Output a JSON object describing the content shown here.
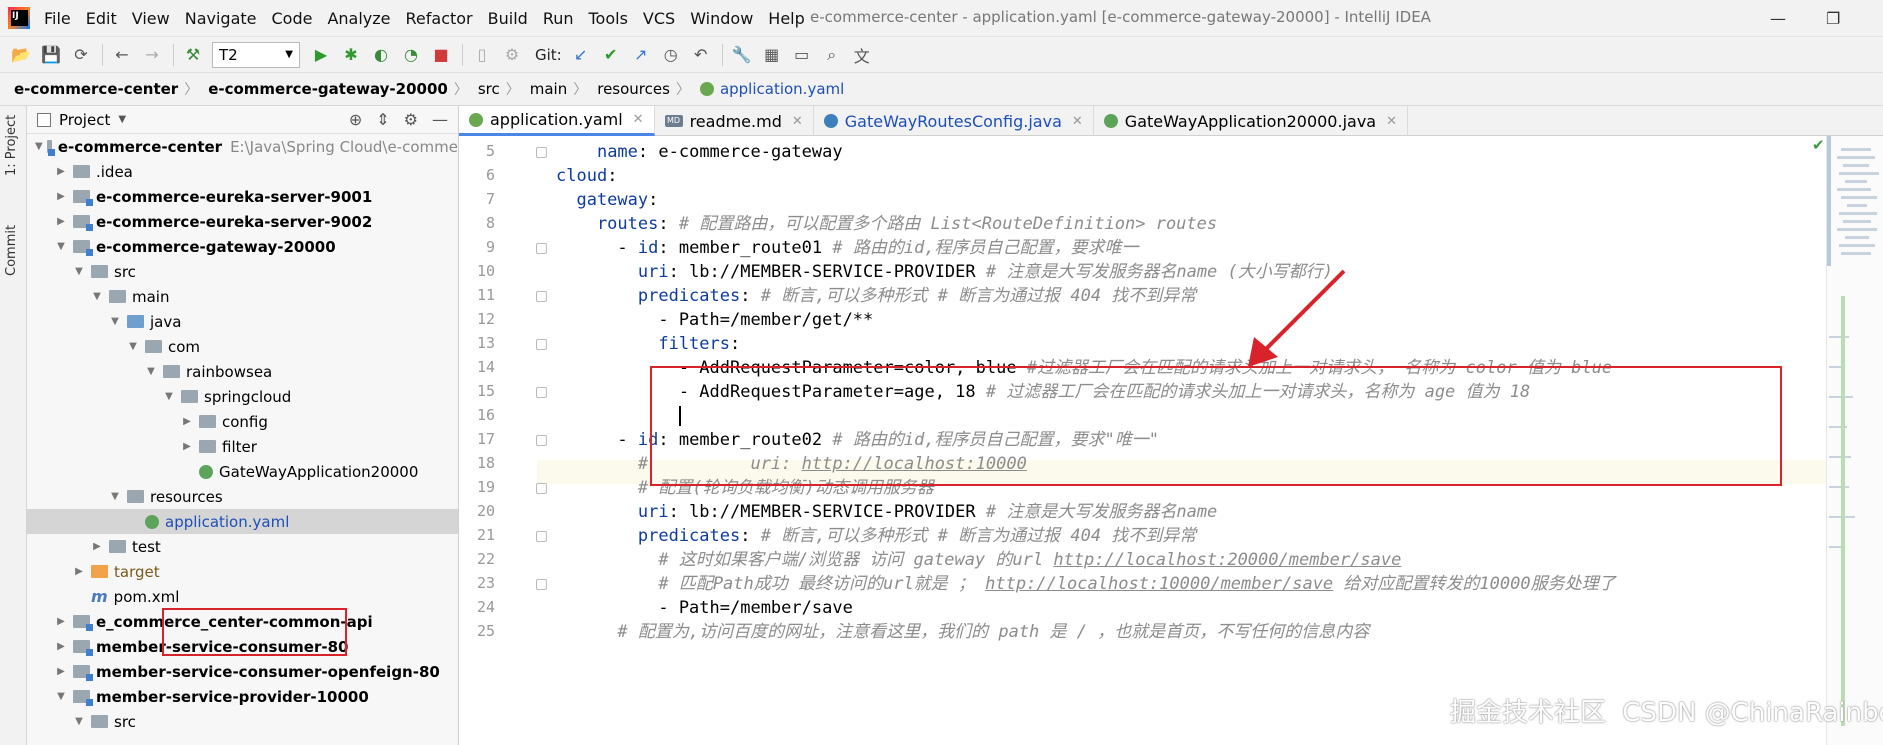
{
  "window": {
    "title": "e-commerce-center - application.yaml [e-commerce-gateway-20000] - IntelliJ IDEA"
  },
  "menu": [
    "File",
    "Edit",
    "View",
    "Navigate",
    "Code",
    "Analyze",
    "Refactor",
    "Build",
    "Run",
    "Tools",
    "VCS",
    "Window",
    "Help"
  ],
  "toolbar": {
    "run_config": "T2",
    "git_label": "Git:"
  },
  "breadcrumb": [
    "e-commerce-center",
    "e-commerce-gateway-20000",
    "src",
    "main",
    "resources",
    "application.yaml"
  ],
  "left_stripe": {
    "project": "1: Project",
    "commit": "Commit"
  },
  "project_panel": {
    "title": "Project",
    "tree": [
      {
        "label": "e-commerce-center",
        "extra": "E:\\Java\\Spring Cloud\\e-comme",
        "indent": 0,
        "arrow": "down",
        "icon": "module",
        "bold": true
      },
      {
        "label": ".idea",
        "indent": 1,
        "arrow": "right",
        "icon": "folder"
      },
      {
        "label": "e-commerce-eureka-server-9001",
        "indent": 1,
        "arrow": "right",
        "icon": "module",
        "bold": true
      },
      {
        "label": "e-commerce-eureka-server-9002",
        "indent": 1,
        "arrow": "right",
        "icon": "module",
        "bold": true
      },
      {
        "label": "e-commerce-gateway-20000",
        "indent": 1,
        "arrow": "down",
        "icon": "module",
        "bold": true
      },
      {
        "label": "src",
        "indent": 2,
        "arrow": "down",
        "icon": "folder"
      },
      {
        "label": "main",
        "indent": 3,
        "arrow": "down",
        "icon": "folder"
      },
      {
        "label": "java",
        "indent": 4,
        "arrow": "down",
        "icon": "src"
      },
      {
        "label": "com",
        "indent": 5,
        "arrow": "down",
        "icon": "folder"
      },
      {
        "label": "rainbowsea",
        "indent": 6,
        "arrow": "down",
        "icon": "folder"
      },
      {
        "label": "springcloud",
        "indent": 7,
        "arrow": "down",
        "icon": "folder"
      },
      {
        "label": "config",
        "indent": 8,
        "arrow": "right",
        "icon": "folder"
      },
      {
        "label": "filter",
        "indent": 8,
        "arrow": "right",
        "icon": "folder"
      },
      {
        "label": "GateWayApplication20000",
        "indent": 8,
        "arrow": "",
        "icon": "spring"
      },
      {
        "label": "resources",
        "indent": 4,
        "arrow": "down",
        "icon": "folder"
      },
      {
        "label": "application.yaml",
        "indent": 5,
        "arrow": "",
        "icon": "yaml",
        "selected": true,
        "blue": true
      },
      {
        "label": "test",
        "indent": 3,
        "arrow": "right",
        "icon": "folder"
      },
      {
        "label": "target",
        "indent": 2,
        "arrow": "right",
        "icon": "orange",
        "orange": true
      },
      {
        "label": "pom.xml",
        "indent": 2,
        "arrow": "",
        "icon": "maven"
      },
      {
        "label": "e_commerce_center-common-api",
        "indent": 1,
        "arrow": "right",
        "icon": "module",
        "bold": true
      },
      {
        "label": "member-service-consumer-80",
        "indent": 1,
        "arrow": "right",
        "icon": "module",
        "bold": true
      },
      {
        "label": "member-service-consumer-openfeign-80",
        "indent": 1,
        "arrow": "right",
        "icon": "module",
        "bold": true
      },
      {
        "label": "member-service-provider-10000",
        "indent": 1,
        "arrow": "down",
        "icon": "module",
        "bold": true
      },
      {
        "label": "src",
        "indent": 2,
        "arrow": "down",
        "icon": "folder"
      }
    ]
  },
  "tabs": [
    {
      "label": "application.yaml",
      "icon": "yaml",
      "active": true
    },
    {
      "label": "readme.md",
      "icon": "md"
    },
    {
      "label": "GateWayRoutesConfig.java",
      "icon": "java",
      "blue": true
    },
    {
      "label": "GateWayApplication20000.java",
      "icon": "spring"
    }
  ],
  "editor": {
    "line_numbers": [
      "5",
      "6",
      "7",
      "8",
      "9",
      "10",
      "11",
      "12",
      "13",
      "14",
      "15",
      "16",
      "17",
      "18",
      "19",
      "20",
      "21",
      "22",
      "23",
      "24",
      "25"
    ],
    "lines": [
      [
        {
          "s": "    ",
          "c": "t"
        },
        {
          "s": "name",
          "c": "k"
        },
        {
          "s": ": e-commerce-gateway",
          "c": "t"
        }
      ],
      [
        {
          "s": "cloud",
          "c": "k"
        },
        {
          "s": ":",
          "c": "t"
        }
      ],
      [
        {
          "s": "  gateway",
          "c": "k"
        },
        {
          "s": ":",
          "c": "t"
        }
      ],
      [
        {
          "s": "    routes",
          "c": "k"
        },
        {
          "s": ": ",
          "c": "t"
        },
        {
          "s": "# 配置路由，可以配置多个路由 List<RouteDefinition> routes",
          "c": "c"
        }
      ],
      [
        {
          "s": "      - ",
          "c": "t"
        },
        {
          "s": "id",
          "c": "k"
        },
        {
          "s": ": member_route01 ",
          "c": "t"
        },
        {
          "s": "# 路由的id,程序员自己配置，要求唯一",
          "c": "c"
        }
      ],
      [
        {
          "s": "        uri",
          "c": "k"
        },
        {
          "s": ": lb://MEMBER-SERVICE-PROVIDER ",
          "c": "t"
        },
        {
          "s": "# 注意是大写发服务器名name (大小写都行)",
          "c": "c"
        }
      ],
      [
        {
          "s": "        predicates",
          "c": "k"
        },
        {
          "s": ": ",
          "c": "t"
        },
        {
          "s": "# 断言,可以多种形式 # 断言为通过报 404 找不到异常",
          "c": "c"
        }
      ],
      [
        {
          "s": "          - Path=/member/get/**",
          "c": "t"
        }
      ],
      [
        {
          "s": "          filters",
          "c": "k"
        },
        {
          "s": ":",
          "c": "t"
        }
      ],
      [
        {
          "s": "            - AddRequestParameter=color, blue ",
          "c": "t"
        },
        {
          "s": "#过滤器工厂会在匹配的请求头加上一对请求头， 名称为 color 值为 blue",
          "c": "c"
        }
      ],
      [
        {
          "s": "            - AddRequestParameter=age, 18 ",
          "c": "t"
        },
        {
          "s": "# 过滤器工厂会在匹配的请求头加上一对请求头，名称为 age 值为 18",
          "c": "c"
        }
      ],
      [
        {
          "s": "            ",
          "c": "t"
        },
        {
          "s": "",
          "c": "caret"
        }
      ],
      [
        {
          "s": "      - ",
          "c": "t"
        },
        {
          "s": "id",
          "c": "k"
        },
        {
          "s": ": member_route02 ",
          "c": "t"
        },
        {
          "s": "# 路由的id,程序员自己配置，要求\"唯一\"",
          "c": "c"
        }
      ],
      [
        {
          "s": "        #          uri: ",
          "c": "c"
        },
        {
          "s": "http://localhost:10000",
          "c": "u"
        }
      ],
      [
        {
          "s": "        # 配置(轮询负载均衡)动态调用服务器",
          "c": "c"
        }
      ],
      [
        {
          "s": "        uri",
          "c": "k"
        },
        {
          "s": ": lb://MEMBER-SERVICE-PROVIDER ",
          "c": "t"
        },
        {
          "s": "# 注意是大写发服务器名name",
          "c": "c"
        }
      ],
      [
        {
          "s": "        predicates",
          "c": "k"
        },
        {
          "s": ": ",
          "c": "t"
        },
        {
          "s": "# 断言,可以多种形式 # 断言为通过报 404 找不到异常",
          "c": "c"
        }
      ],
      [
        {
          "s": "          # 这时如果客户端/浏览器 访问 gateway 的url ",
          "c": "c"
        },
        {
          "s": "http://localhost:20000/member/save",
          "c": "u"
        }
      ],
      [
        {
          "s": "          # 匹配Path成功 最终访问的url就是 ； ",
          "c": "c"
        },
        {
          "s": "http://localhost:10000/member/save",
          "c": "u"
        },
        {
          "s": " 给对应配置转发的10000服务处理了",
          "c": "c"
        }
      ],
      [
        {
          "s": "          - Path=/member/save",
          "c": "t"
        }
      ],
      [
        {
          "s": "      # 配置为,访问百度的网址，注意看这里，我们的 path 是 / ，也就是首页，不写任何的信息内容",
          "c": "c"
        }
      ]
    ]
  },
  "watermark": "CSDN @ChinaRainbowSea",
  "watermark2": "掘金技术社区"
}
